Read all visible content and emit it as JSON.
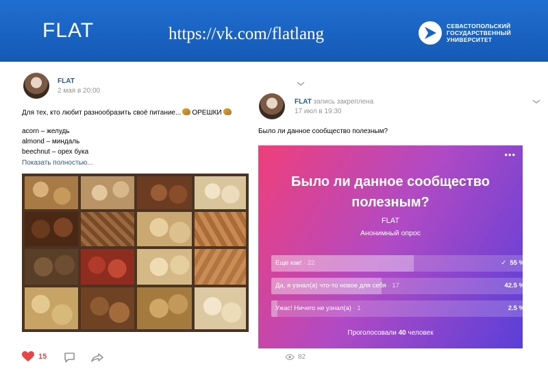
{
  "header": {
    "brand": "FLAT",
    "url": "https://vk.com/flatlang",
    "university_lines": [
      "СЕВАСТОПОЛЬСКИЙ",
      "ГОСУДАРСТВЕННЫЙ",
      "УНИВЕРСИТЕТ"
    ],
    "university_logo_icon": "sevsu-logo-icon"
  },
  "left_post": {
    "author": "FLAT",
    "date": "2 мая в 20:00",
    "intro": "Для тех, кто любит разнообразить своё питание...",
    "highlight": "ОРЕШКИ",
    "lines": [
      "acorn – желудь",
      "almond – миндаль",
      "beechnut – орех бука"
    ],
    "show_more": "Показать полностью...",
    "likes": "15",
    "icons": [
      "heart-icon",
      "comment-icon",
      "share-icon",
      "chevron-down-icon"
    ]
  },
  "right_post": {
    "author": "FLAT",
    "pinned": "запись закреплена",
    "date": "17 июл в 19:30",
    "question": "Было ли данное сообщество полезным?",
    "views": "82",
    "poll": {
      "title_line1": "Было ли данное сообщество",
      "title_line2": "полезным?",
      "owner": "FLAT",
      "kind": "Анонимный опрос",
      "menu": "•••",
      "options": [
        {
          "label": "Еще как!",
          "count": "· 22",
          "percent": "55 %",
          "share": 0.55,
          "checked": true
        },
        {
          "label": "Да, я узнал(а) что-то новое для себя",
          "count": "· 17",
          "percent": "42.5 %",
          "share": 0.425,
          "checked": false
        },
        {
          "label": "Ужас! Ничего не узнал(а)",
          "count": "· 1",
          "percent": "2.5 %",
          "share": 0.025,
          "checked": false
        }
      ],
      "voted_prefix": "Проголосовали",
      "voted_count": "40",
      "voted_suffix": "человек"
    }
  },
  "colors": {
    "header_blue": "#1a63c2",
    "link_blue": "#2a5885",
    "like_red": "#e64646",
    "poll_gradient": [
      "#ef3f7a",
      "#b24ac4",
      "#5a3fd8"
    ]
  }
}
